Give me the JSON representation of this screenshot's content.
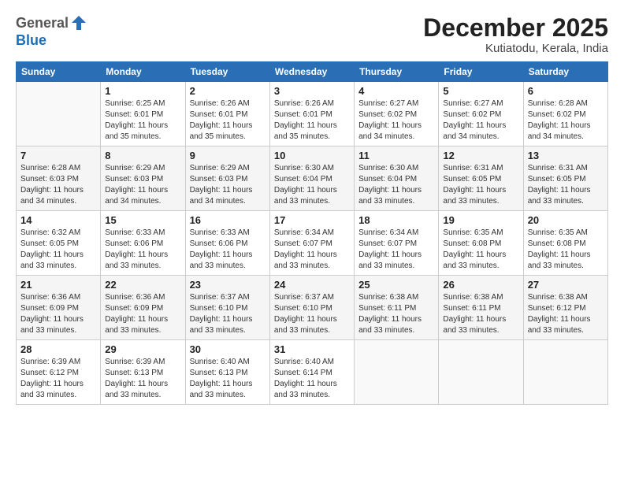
{
  "logo": {
    "general": "General",
    "blue": "Blue"
  },
  "header": {
    "month": "December 2025",
    "location": "Kutiatodu, Kerala, India"
  },
  "weekdays": [
    "Sunday",
    "Monday",
    "Tuesday",
    "Wednesday",
    "Thursday",
    "Friday",
    "Saturday"
  ],
  "weeks": [
    [
      {
        "day": "",
        "info": ""
      },
      {
        "day": "1",
        "info": "Sunrise: 6:25 AM\nSunset: 6:01 PM\nDaylight: 11 hours\nand 35 minutes."
      },
      {
        "day": "2",
        "info": "Sunrise: 6:26 AM\nSunset: 6:01 PM\nDaylight: 11 hours\nand 35 minutes."
      },
      {
        "day": "3",
        "info": "Sunrise: 6:26 AM\nSunset: 6:01 PM\nDaylight: 11 hours\nand 35 minutes."
      },
      {
        "day": "4",
        "info": "Sunrise: 6:27 AM\nSunset: 6:02 PM\nDaylight: 11 hours\nand 34 minutes."
      },
      {
        "day": "5",
        "info": "Sunrise: 6:27 AM\nSunset: 6:02 PM\nDaylight: 11 hours\nand 34 minutes."
      },
      {
        "day": "6",
        "info": "Sunrise: 6:28 AM\nSunset: 6:02 PM\nDaylight: 11 hours\nand 34 minutes."
      }
    ],
    [
      {
        "day": "7",
        "info": "Sunrise: 6:28 AM\nSunset: 6:03 PM\nDaylight: 11 hours\nand 34 minutes."
      },
      {
        "day": "8",
        "info": "Sunrise: 6:29 AM\nSunset: 6:03 PM\nDaylight: 11 hours\nand 34 minutes."
      },
      {
        "day": "9",
        "info": "Sunrise: 6:29 AM\nSunset: 6:03 PM\nDaylight: 11 hours\nand 34 minutes."
      },
      {
        "day": "10",
        "info": "Sunrise: 6:30 AM\nSunset: 6:04 PM\nDaylight: 11 hours\nand 33 minutes."
      },
      {
        "day": "11",
        "info": "Sunrise: 6:30 AM\nSunset: 6:04 PM\nDaylight: 11 hours\nand 33 minutes."
      },
      {
        "day": "12",
        "info": "Sunrise: 6:31 AM\nSunset: 6:05 PM\nDaylight: 11 hours\nand 33 minutes."
      },
      {
        "day": "13",
        "info": "Sunrise: 6:31 AM\nSunset: 6:05 PM\nDaylight: 11 hours\nand 33 minutes."
      }
    ],
    [
      {
        "day": "14",
        "info": "Sunrise: 6:32 AM\nSunset: 6:05 PM\nDaylight: 11 hours\nand 33 minutes."
      },
      {
        "day": "15",
        "info": "Sunrise: 6:33 AM\nSunset: 6:06 PM\nDaylight: 11 hours\nand 33 minutes."
      },
      {
        "day": "16",
        "info": "Sunrise: 6:33 AM\nSunset: 6:06 PM\nDaylight: 11 hours\nand 33 minutes."
      },
      {
        "day": "17",
        "info": "Sunrise: 6:34 AM\nSunset: 6:07 PM\nDaylight: 11 hours\nand 33 minutes."
      },
      {
        "day": "18",
        "info": "Sunrise: 6:34 AM\nSunset: 6:07 PM\nDaylight: 11 hours\nand 33 minutes."
      },
      {
        "day": "19",
        "info": "Sunrise: 6:35 AM\nSunset: 6:08 PM\nDaylight: 11 hours\nand 33 minutes."
      },
      {
        "day": "20",
        "info": "Sunrise: 6:35 AM\nSunset: 6:08 PM\nDaylight: 11 hours\nand 33 minutes."
      }
    ],
    [
      {
        "day": "21",
        "info": "Sunrise: 6:36 AM\nSunset: 6:09 PM\nDaylight: 11 hours\nand 33 minutes."
      },
      {
        "day": "22",
        "info": "Sunrise: 6:36 AM\nSunset: 6:09 PM\nDaylight: 11 hours\nand 33 minutes."
      },
      {
        "day": "23",
        "info": "Sunrise: 6:37 AM\nSunset: 6:10 PM\nDaylight: 11 hours\nand 33 minutes."
      },
      {
        "day": "24",
        "info": "Sunrise: 6:37 AM\nSunset: 6:10 PM\nDaylight: 11 hours\nand 33 minutes."
      },
      {
        "day": "25",
        "info": "Sunrise: 6:38 AM\nSunset: 6:11 PM\nDaylight: 11 hours\nand 33 minutes."
      },
      {
        "day": "26",
        "info": "Sunrise: 6:38 AM\nSunset: 6:11 PM\nDaylight: 11 hours\nand 33 minutes."
      },
      {
        "day": "27",
        "info": "Sunrise: 6:38 AM\nSunset: 6:12 PM\nDaylight: 11 hours\nand 33 minutes."
      }
    ],
    [
      {
        "day": "28",
        "info": "Sunrise: 6:39 AM\nSunset: 6:12 PM\nDaylight: 11 hours\nand 33 minutes."
      },
      {
        "day": "29",
        "info": "Sunrise: 6:39 AM\nSunset: 6:13 PM\nDaylight: 11 hours\nand 33 minutes."
      },
      {
        "day": "30",
        "info": "Sunrise: 6:40 AM\nSunset: 6:13 PM\nDaylight: 11 hours\nand 33 minutes."
      },
      {
        "day": "31",
        "info": "Sunrise: 6:40 AM\nSunset: 6:14 PM\nDaylight: 11 hours\nand 33 minutes."
      },
      {
        "day": "",
        "info": ""
      },
      {
        "day": "",
        "info": ""
      },
      {
        "day": "",
        "info": ""
      }
    ]
  ]
}
